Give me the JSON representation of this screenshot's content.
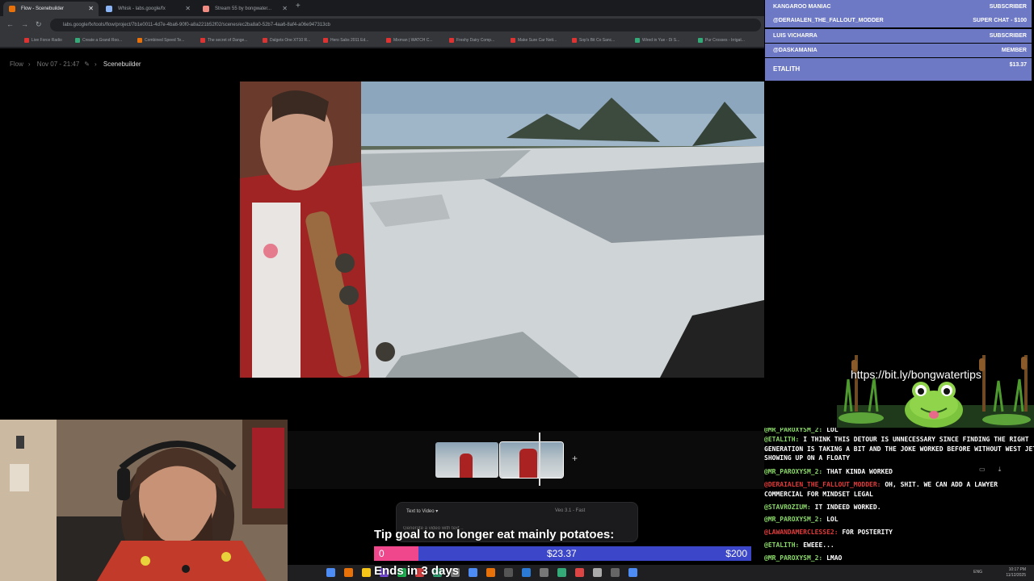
{
  "browser": {
    "tabs": [
      {
        "label": "Flow - Scenebuilder",
        "color": "#e8710a"
      },
      {
        "label": "Whisk - labs.google/fx",
        "color": "#8ab4f8"
      },
      {
        "label": "Stream 55 by bongwater...",
        "color": "#f28b82"
      }
    ],
    "new_tab": "+",
    "url": "labs.google/fx/tools/flow/project/7b1e0011-4d7e-4ba6-90f0-a8a221b52f02/scenes/ec2ba8a0-52b7-4aa6-8af4-a06e947313cb",
    "bookmarks": [
      "Live Force Radio",
      "Create a Grand Roo...",
      "Combined Speed Te...",
      "The secret of Dange...",
      "Dalgets One XT10 R...",
      "Hero Sabs 2011 Ed...",
      "Mixman | WATCH C...",
      "Freshy Dairy Comp...",
      "Make Sure Car Nett...",
      "Sop's Bit Co Sanc...",
      "Wired in Yue - Di S...",
      "Pur Crosses - Irrigat..."
    ]
  },
  "flow": {
    "breadcrumb": [
      "Flow",
      "Nov 07 - 21:47",
      "Scenebuilder"
    ],
    "add_clip": "+",
    "prompt_mode": "Text to Video  ▾",
    "prompt_model": "Veo 3.1 - Fast",
    "prompt_placeholder": "Generate a video with text..."
  },
  "tip_goal": {
    "title": "Tip goal to no longer eat mainly potatoes:",
    "start": "0",
    "current": "$23.37",
    "goal": "$200",
    "progress": 0.1169,
    "ends": "Ends in 3 days",
    "fill_color": "#f0468c",
    "bar_color": "#3c46c8"
  },
  "alerts": [
    {
      "name": "KANGAROO MANIAC",
      "type": "SUBSCRIBER"
    },
    {
      "name": "@DERAIALEN_THE_FALLOUT_MODDER",
      "type": "SUPER CHAT - $100"
    },
    {
      "name": "LUIS VICHARRA",
      "type": "SUBSCRIBER"
    },
    {
      "name": "@DASKAMANIA",
      "type": "MEMBER"
    },
    {
      "name": "ETALITH",
      "type": "$13.37"
    }
  ],
  "promo_link": "https://bit.ly/bongwatertips",
  "chat": [
    {
      "user": "@MR_PAROXYSM_2:",
      "text": "LOL",
      "red": false
    },
    {
      "user": "@ETALITH:",
      "text": "I THINK THIS DETOUR IS UNNECESSARY SINCE FINDING THE RIGHT",
      "red": false
    },
    {
      "user": "",
      "text": "GENERATION IS TAKING A BIT AND THE JOKE WORKED BEFORE WITHOUT WEST JET",
      "red": false
    },
    {
      "user": "",
      "text": "SHOWING UP ON A FLOATY",
      "red": false
    },
    {
      "user": "@MR_PAROXYSM_2:",
      "text": "THAT KINDA WORKED",
      "red": false
    },
    {
      "user": "@DERAIALEN_THE_FALLOUT_MODDER:",
      "text": "OH, SHIT. WE CAN ADD A LAWYER",
      "red": true
    },
    {
      "user": "",
      "text": "COMMERCIAL FOR MINDSET LEGAL",
      "red": false
    },
    {
      "user": "@STAVROZIUM:",
      "text": "IT INDEED WORKED.",
      "red": false
    },
    {
      "user": "@MR_PAROXYSM_2:",
      "text": "LOL",
      "red": false
    },
    {
      "user": "@LAWANDAMERCLESSE2:",
      "text": "FOR POSTERITY",
      "red": true
    },
    {
      "user": "@ETALITH:",
      "text": "EWEEE...",
      "red": false
    },
    {
      "user": "@MR_PAROXYSM_2:",
      "text": "LMAO",
      "red": false
    }
  ],
  "taskbar": {
    "icon_colors": [
      "#4d8bf5",
      "#e8710a",
      "#f5c518",
      "#7b4de0",
      "#1db954",
      "#d44",
      "#3a7",
      "#888",
      "#4d8bf5",
      "#e8710a",
      "#555",
      "#2b7bd6",
      "#777",
      "#3a7",
      "#d44",
      "#aaa",
      "#666",
      "#4d8bf5"
    ],
    "tray_time": "10:17 PM",
    "tray_date": "11/12/2025",
    "tray_lang": "ENG"
  }
}
